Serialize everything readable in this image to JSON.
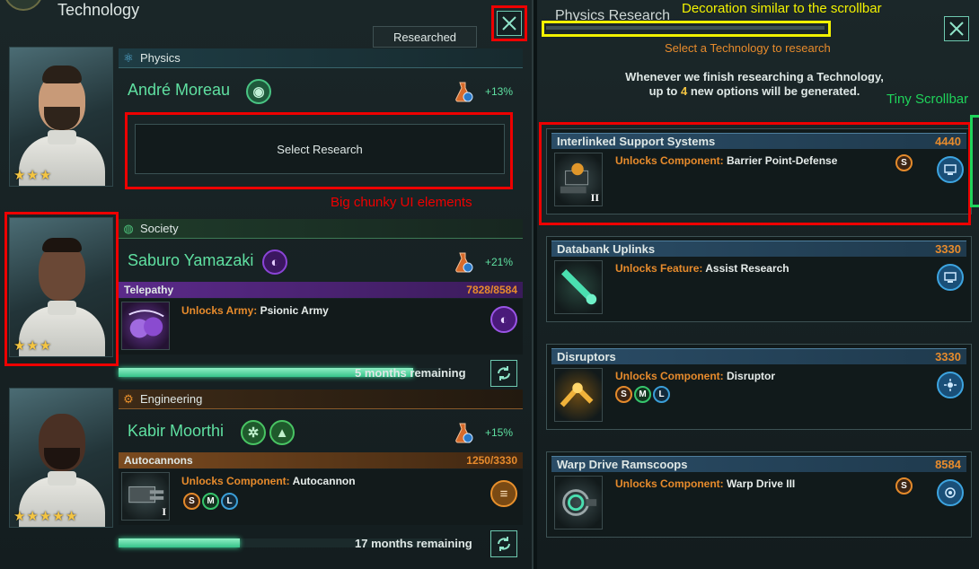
{
  "left": {
    "title": "Technology",
    "researched_label": "Researched",
    "select_research_label": "Select Research",
    "categories": {
      "physics": {
        "label": "Physics",
        "scientist": "André Moreau",
        "bonus": "+13%",
        "stars": 3
      },
      "society": {
        "label": "Society",
        "scientist": "Saburo Yamazaki",
        "bonus": "+21%",
        "stars": 3,
        "project": {
          "name": "Telepathy",
          "progress_text": "7828/8584",
          "progress": 0.912,
          "unlock_type": "Unlocks Army:",
          "unlock_name": "Psionic Army",
          "remaining": "5 months remaining"
        }
      },
      "engineering": {
        "label": "Engineering",
        "scientist": "Kabir Moorthi",
        "bonus": "+15%",
        "stars": 5,
        "project": {
          "name": "Autocannons",
          "progress_text": "1250/3330",
          "progress": 0.375,
          "tier": "I",
          "unlock_type": "Unlocks Component:",
          "unlock_name": "Autocannon",
          "slots": [
            "S",
            "M",
            "L"
          ],
          "remaining": "17 months remaining"
        }
      }
    }
  },
  "right": {
    "title": "Physics Research",
    "subtitle": "Select a Technology to research",
    "info_line1": "Whenever we finish researching a Technology,",
    "info_line2_pre": "up to ",
    "info_line2_num": "4",
    "info_line2_post": " new options will be generated.",
    "cards": [
      {
        "name": "Interlinked Support Systems",
        "cost": "4440",
        "unlock_type": "Unlocks Component:",
        "unlock_name": "Barrier Point-Defense",
        "tier": "II",
        "side_slot": "S",
        "slots": []
      },
      {
        "name": "Databank Uplinks",
        "cost": "3330",
        "unlock_type": "Unlocks Feature:",
        "unlock_name": "Assist Research",
        "tier": "",
        "side_slot": "",
        "slots": []
      },
      {
        "name": "Disruptors",
        "cost": "3330",
        "unlock_type": "Unlocks Component:",
        "unlock_name": "Disruptor",
        "tier": "",
        "side_slot": "",
        "slots": [
          "S",
          "M",
          "L"
        ]
      },
      {
        "name": "Warp Drive Ramscoops",
        "cost": "8584",
        "unlock_type": "Unlocks Component:",
        "unlock_name": "Warp Drive III",
        "tier": "",
        "side_slot": "S",
        "slots": []
      }
    ]
  },
  "annotations": {
    "big_chunky": "Big chunky UI elements",
    "decoration": "Decoration similar to the scrollbar",
    "tiny_scrollbar": "Tiny Scrollbar"
  },
  "colors": {
    "accent_green": "#5fe0a1",
    "accent_orange": "#e78b2c",
    "society_purple": "#7a2fb8",
    "engineering_orange": "#b8661f",
    "annotation_red": "#e00000",
    "annotation_yellow": "#f2f200",
    "annotation_green": "#1fd35a"
  }
}
